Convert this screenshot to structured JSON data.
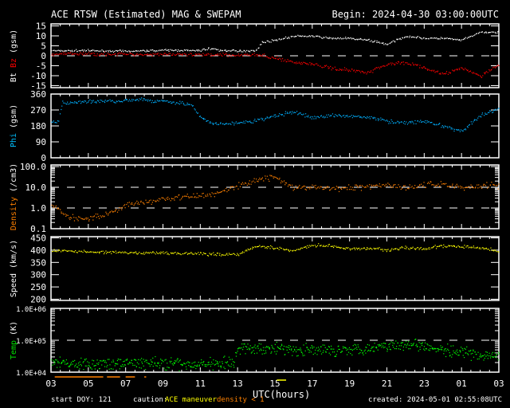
{
  "chart_data": {
    "type": "scatter",
    "title": "ACE RTSW (Estimated) MAG & SWEPAM",
    "begin": "Begin: 2024-04-30 03:00:00UTC",
    "xlabel": "UTC(hours)",
    "x_ticks": [
      "03",
      "05",
      "07",
      "09",
      "11",
      "13",
      "15",
      "17",
      "19",
      "21",
      "23",
      "01",
      "03"
    ],
    "x_range_hours": [
      0,
      24
    ],
    "footer": {
      "start_doy": "start DOY: 121",
      "caution_label": "caution:",
      "caution_maneuver": "ACE maneuver",
      "caution_density": "density < 1",
      "created": "created: 2024-05-01 02:55:08UTC"
    },
    "caution_intervals": {
      "maneuver": [
        [
          12.1,
          12.6
        ]
      ],
      "density_lt_1": [
        [
          0.2,
          2.8
        ],
        [
          3.0,
          3.7
        ],
        [
          4.0,
          4.5
        ],
        [
          5.0,
          5.1
        ]
      ]
    },
    "panels": [
      {
        "id": "mag",
        "ylabel_parts": [
          "Bt",
          "Bz",
          "(gsm)"
        ],
        "ylabel_colors": [
          "#ffffff",
          "#ff0000",
          "#ffffff"
        ],
        "scale": "linear",
        "ylim": [
          -16,
          16
        ],
        "ticks": [
          15,
          10,
          5,
          0,
          -5,
          -10,
          -15
        ],
        "tick_labels": [
          "15",
          "10",
          "5",
          "0",
          "-5",
          "-10",
          "-15"
        ],
        "dashed": [
          0
        ],
        "series": [
          {
            "name": "Bt",
            "color": "#ffffff",
            "noise": 0.4,
            "hours": [
              0,
              2,
              4,
              6,
              8,
              8.5,
              9,
              10,
              11,
              11.3,
              12,
              13,
              14,
              15,
              16,
              17,
              18,
              19,
              20,
              21,
              22,
              23,
              24
            ],
            "values": [
              2.8,
              2.8,
              2.5,
              3,
              2.8,
              4,
              3,
              2.5,
              3,
              7,
              8,
              10,
              10,
              9,
              9,
              8,
              6,
              10,
              9,
              9,
              8,
              12,
              12
            ]
          },
          {
            "name": "Bz",
            "color": "#ff0000",
            "noise": 0.7,
            "hours": [
              0,
              2,
              4,
              6,
              8,
              9,
              10,
              11,
              12,
              13,
              14,
              15,
              16,
              17,
              18,
              19,
              20,
              21,
              22,
              23,
              24
            ],
            "values": [
              1,
              1.2,
              1,
              1,
              0.5,
              1,
              0.5,
              0.8,
              -1,
              -3,
              -4,
              -6,
              -7,
              -8,
              -4,
              -3,
              -6,
              -9,
              -6,
              -10,
              -4
            ]
          }
        ]
      },
      {
        "id": "phi",
        "ylabel_parts": [
          "Phi",
          "(gsm)"
        ],
        "ylabel_colors": [
          "#00c0ff",
          "#ffffff"
        ],
        "scale": "linear",
        "ylim": [
          0,
          360
        ],
        "ticks": [
          360,
          270,
          180,
          90,
          0
        ],
        "tick_labels": [
          "360",
          "270",
          "180",
          "90",
          "0"
        ],
        "dashed": [],
        "series": [
          {
            "name": "Phi",
            "color": "#00b0ff",
            "noise": 8,
            "hours": [
              0,
              0.4,
              0.6,
              2,
              4,
              5,
              5.5,
              6,
              7,
              7.5,
              8,
              8.5,
              9,
              10,
              11,
              12,
              13,
              14,
              15,
              16,
              17,
              18,
              19,
              20,
              21,
              22,
              23,
              24
            ],
            "values": [
              200,
              210,
              310,
              320,
              325,
              330,
              320,
              325,
              310,
              300,
              230,
              200,
              190,
              200,
              210,
              240,
              260,
              230,
              240,
              240,
              230,
              210,
              200,
              210,
              180,
              150,
              240,
              280
            ]
          }
        ]
      },
      {
        "id": "density",
        "ylabel_parts": [
          "Density",
          "(/cm3)"
        ],
        "ylabel_colors": [
          "#ff8000",
          "#ffffff"
        ],
        "scale": "log",
        "ylim": [
          0.1,
          120
        ],
        "ticks": [
          100,
          10,
          1,
          0.1
        ],
        "tick_labels": [
          "100.0",
          "10.0",
          "1.0",
          "0.1"
        ],
        "dashed": [
          10,
          1
        ],
        "series": [
          {
            "name": "Density",
            "color": "#ff8000",
            "noise": 0.12,
            "hours": [
              0,
              0.5,
              1,
              2,
              3,
              4,
              5,
              6,
              7,
              8,
              9,
              10,
              11,
              12,
              13,
              14,
              15,
              16,
              17,
              18,
              19,
              20,
              21,
              22,
              23,
              24
            ],
            "values": [
              1.5,
              0.8,
              0.35,
              0.35,
              0.5,
              1.5,
              2,
              3,
              3.5,
              4,
              6,
              12,
              25,
              35,
              10,
              10,
              9,
              10,
              12,
              14,
              10,
              14,
              15,
              10,
              12,
              14
            ]
          }
        ]
      },
      {
        "id": "speed",
        "ylabel_parts": [
          "Speed",
          "(km/s)"
        ],
        "ylabel_colors": [
          "#ffffff",
          "#ffffff"
        ],
        "scale": "linear",
        "ylim": [
          195,
          455
        ],
        "ticks": [
          450,
          400,
          350,
          300,
          250,
          200
        ],
        "tick_labels": [
          "450",
          "400",
          "350",
          "300",
          "250",
          "200"
        ],
        "dashed": [],
        "series": [
          {
            "name": "Speed",
            "color": "#ffff00",
            "noise": 5,
            "hours": [
              0,
              2,
              4,
              6,
              8,
              8.5,
              9,
              8.8,
              10,
              11,
              12,
              13,
              14,
              15,
              16,
              17,
              18,
              19,
              20,
              21,
              22,
              23,
              24
            ],
            "values": [
              400,
              395,
              390,
              390,
              388,
              385,
              385,
              385,
              385,
              420,
              410,
              400,
              422,
              420,
              405,
              410,
              402,
              412,
              405,
              420,
              415,
              412,
              398
            ]
          }
        ]
      },
      {
        "id": "temp",
        "ylabel_parts": [
          "Temp",
          "(K)"
        ],
        "ylabel_colors": [
          "#00e000",
          "#ffffff"
        ],
        "scale": "log",
        "ylim": [
          10000,
          1000000
        ],
        "ticks": [
          1000000,
          100000,
          10000
        ],
        "tick_labels": [
          "1.0E+06",
          "1.0E+05",
          "1.0E+04"
        ],
        "dashed": [
          100000
        ],
        "series": [
          {
            "name": "Temp",
            "color": "#00ff00",
            "noise": 0.15,
            "hours": [
              0,
              2,
              4,
              6,
              8,
              8.5,
              9,
              9.8,
              10,
              11,
              12,
              13,
              14,
              15,
              16,
              17,
              18,
              19,
              20,
              21,
              22,
              23,
              24
            ],
            "values": [
              20000,
              18000,
              20000,
              19000,
              18000,
              20000,
              20000,
              20000,
              60000,
              55000,
              60000,
              50000,
              50000,
              50000,
              55000,
              60000,
              70000,
              80000,
              70000,
              50000,
              40000,
              35000,
              30000
            ]
          }
        ]
      }
    ]
  }
}
